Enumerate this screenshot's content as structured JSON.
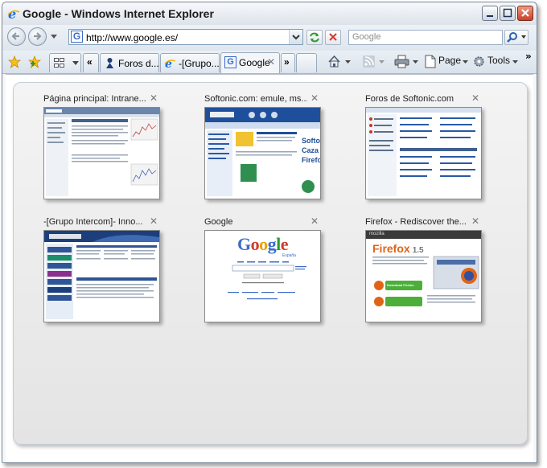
{
  "window": {
    "title": "Google - Windows Internet Explorer"
  },
  "navbar": {
    "url": "http://www.google.es/",
    "search_placeholder": "Google"
  },
  "tabs": [
    {
      "label": "Foros d...",
      "icon": "softonic-forum-icon"
    },
    {
      "label": "-[Grupo...",
      "icon": "ie-page-icon"
    },
    {
      "label": "Google",
      "icon": "google-g-icon",
      "active": true
    }
  ],
  "command_bar": {
    "page_label": "Page",
    "tools_label": "Tools"
  },
  "quick_tabs": [
    {
      "title": "Página principal: Intrane...",
      "thumbnail": "intranet-page"
    },
    {
      "title": "Softonic.com: emule, ms...",
      "thumbnail": "softonic-home"
    },
    {
      "title": "Foros de Softonic.com",
      "thumbnail": "softonic-forums"
    },
    {
      "title": "-[Grupo Intercom]- Inno...",
      "thumbnail": "grupo-intercom"
    },
    {
      "title": "Google",
      "thumbnail": "google-home",
      "logo_text": "Google",
      "logo_sub": "España"
    },
    {
      "title": "Firefox - Rediscover the...",
      "thumbnail": "mozilla-firefox",
      "site_text": "mozilla",
      "headline": "Firefox",
      "version": "1.5",
      "download_label": "Download Firefox"
    }
  ],
  "colors": {
    "close_button": "#c9412a",
    "softonic_blue": "#1f4f9a",
    "google_blue": "#3c6cc8",
    "firefox_orange": "#e06418"
  }
}
